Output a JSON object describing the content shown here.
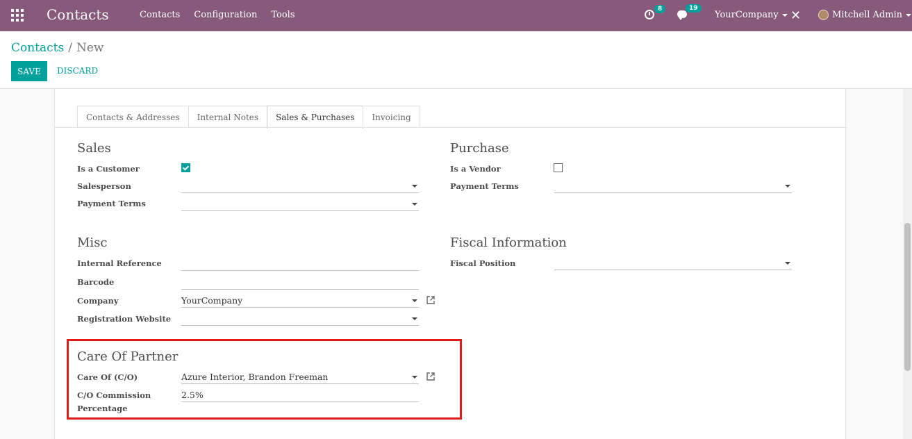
{
  "navbar": {
    "app_title": "Contacts",
    "menu": [
      "Contacts",
      "Configuration",
      "Tools"
    ],
    "activity_count": "8",
    "message_count": "19",
    "company": "YourCompany",
    "user": "Mitchell Admin",
    "color": "#875a7b"
  },
  "breadcrumb": {
    "parent": "Contacts",
    "separator": "/",
    "current": "New"
  },
  "actions": {
    "save": "SAVE",
    "discard": "DISCARD"
  },
  "tabs": [
    "Contacts & Addresses",
    "Internal Notes",
    "Sales & Purchases",
    "Invoicing"
  ],
  "active_tab": "Sales & Purchases",
  "sales": {
    "title": "Sales",
    "is_customer_label": "Is a Customer",
    "is_customer": true,
    "salesperson_label": "Salesperson",
    "salesperson": "",
    "payment_terms_label": "Payment Terms",
    "payment_terms": ""
  },
  "purchase": {
    "title": "Purchase",
    "is_vendor_label": "Is a Vendor",
    "is_vendor": false,
    "payment_terms_label": "Payment Terms",
    "payment_terms": ""
  },
  "misc": {
    "title": "Misc",
    "internal_ref_label": "Internal Reference",
    "internal_ref": "",
    "barcode_label": "Barcode",
    "barcode": "",
    "company_label": "Company",
    "company": "YourCompany",
    "reg_website_label": "Registration Website",
    "reg_website": ""
  },
  "fiscal": {
    "title": "Fiscal Information",
    "fiscal_position_label": "Fiscal Position",
    "fiscal_position": ""
  },
  "care_of": {
    "title": "Care Of Partner",
    "care_of_label": "Care Of (C/O)",
    "care_of": "Azure Interior, Brandon Freeman",
    "commission_label_1": "C/O Commission",
    "commission_label_2": "Percentage",
    "commission": "2.5%"
  },
  "accent": "#00a09d"
}
